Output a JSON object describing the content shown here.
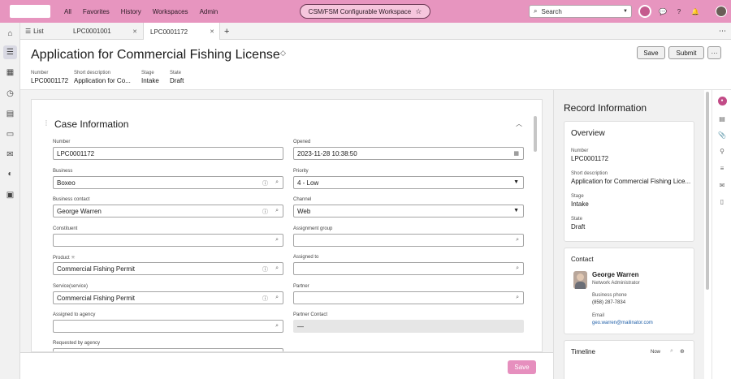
{
  "topnav": {
    "links": [
      "All",
      "Favorites",
      "History",
      "Workspaces",
      "Admin"
    ],
    "workspace_label": "CSM/FSM Configurable Workspace",
    "search_placeholder": "Search"
  },
  "tabs": {
    "list_label": "List",
    "items": [
      {
        "label": "LPC0001001"
      },
      {
        "label": "LPC0001172"
      }
    ]
  },
  "record": {
    "title": "Application for Commercial Fishing License",
    "save_label": "Save",
    "submit_label": "Submit",
    "more_label": "···",
    "fields": [
      {
        "label": "Number",
        "value": "LPC0001172"
      },
      {
        "label": "Short description",
        "value": "Application for Co..."
      },
      {
        "label": "Stage",
        "value": "Intake"
      },
      {
        "label": "State",
        "value": "Draft"
      }
    ]
  },
  "case_info": {
    "title": "Case Information",
    "left": [
      {
        "label": "Number",
        "value": ""
      },
      {
        "label": "Business",
        "value": "Boxeo"
      },
      {
        "label": "Business contact",
        "value": "George Warren"
      },
      {
        "label": "Constituent",
        "value": ""
      },
      {
        "label": "Product",
        "value": "Commercial Fishing Permit"
      },
      {
        "label": "Service(service)",
        "value": "Commercial Fishing Permit"
      },
      {
        "label": "Assigned to agency",
        "value": ""
      },
      {
        "label": "Requested by agency",
        "value": ""
      }
    ],
    "number_value": "LPC0001172",
    "right": [
      {
        "label": "Opened",
        "value": "2023-11-28 10:38:50"
      },
      {
        "label": "Priority",
        "value": "4 - Low"
      },
      {
        "label": "Channel",
        "value": "Web"
      },
      {
        "label": "Assignment group",
        "value": ""
      },
      {
        "label": "Assigned to",
        "value": ""
      },
      {
        "label": "Partner",
        "value": ""
      },
      {
        "label": "Partner Contact",
        "value": "—"
      }
    ]
  },
  "footer": {
    "save_label": "Save"
  },
  "record_info": {
    "title": "Record Information",
    "overview": {
      "title": "Overview",
      "fields": [
        {
          "label": "Number",
          "value": "LPC0001172"
        },
        {
          "label": "Short description",
          "value": "Application for Commercial Fishing Lice..."
        },
        {
          "label": "Stage",
          "value": "Intake"
        },
        {
          "label": "State",
          "value": "Draft"
        }
      ]
    },
    "contact": {
      "title": "Contact",
      "name": "George Warren",
      "role": "Network Administrator",
      "phone_label": "Business phone",
      "phone": "(858) 287-7834",
      "email_label": "Email",
      "email": "geo.warren@mailinator.com"
    },
    "timeline": {
      "title": "Timeline",
      "now_label": "Now"
    }
  },
  "colors": {
    "nav_pink": "#e795bf",
    "save_pink": "#e68fbe",
    "accent": "#c24b87"
  }
}
